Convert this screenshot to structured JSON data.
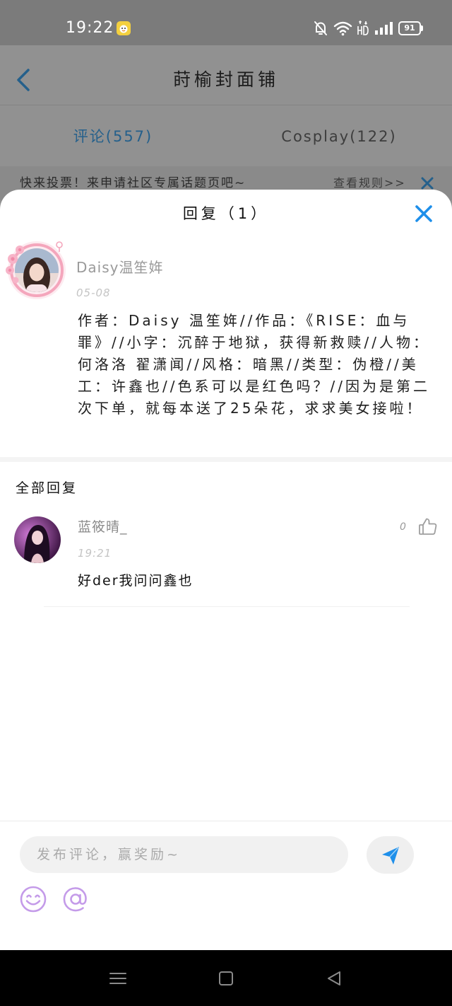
{
  "status_bar": {
    "time": "19:22",
    "battery": "91",
    "icons": [
      "app-notification-icon",
      "bell-off-icon",
      "wifi-icon",
      "hd-icon",
      "signal-icon",
      "battery-icon"
    ]
  },
  "header": {
    "title": "莳榆封面铺",
    "back_icon": "chevron-left-icon"
  },
  "tabs": [
    {
      "label": "评论(557)",
      "selected": true
    },
    {
      "label": "Cosplay(122)",
      "selected": false
    }
  ],
  "banner": {
    "text": "快来投票！来申请社区专属话题页吧~",
    "link": "查看规则>>",
    "close_icon": "close-icon"
  },
  "sheet": {
    "title": "回复（1）",
    "close_icon": "close-icon",
    "comment": {
      "author": "Daisy温笙姩",
      "date": "05-08",
      "text": "作者：Daisy 温笙姩//作品：《RISE：血与罪》//小字：沉醉于地狱，获得新救赎//人物：何洛洛 翟潇闻//风格：暗黑//类型：伪橙//美工：许鑫也//色系可以是红色吗？//因为是第二次下单，就每本送了25朵花，求求美女接啦！"
    },
    "replies_header": "全部回复",
    "replies": [
      {
        "author": "蓝筱晴_",
        "time": "19:21",
        "likes": 0,
        "like_icon": "thumbs-up-icon",
        "text": "好der我问问鑫也"
      }
    ]
  },
  "composer": {
    "placeholder": "发布评论，赢奖励~",
    "send_icon": "paper-plane-icon",
    "emoji_icon": "smiley-icon",
    "mention_icon": "at-icon"
  },
  "nav_bar": {
    "icons": [
      "menu-icon",
      "home-icon",
      "back-triangle-icon"
    ]
  },
  "colors": {
    "accent": "#1e8fea",
    "secondary_icon": "#c49be9",
    "status_bar_bg": "#7b7b7b",
    "nav_bar_bg": "#000000"
  }
}
